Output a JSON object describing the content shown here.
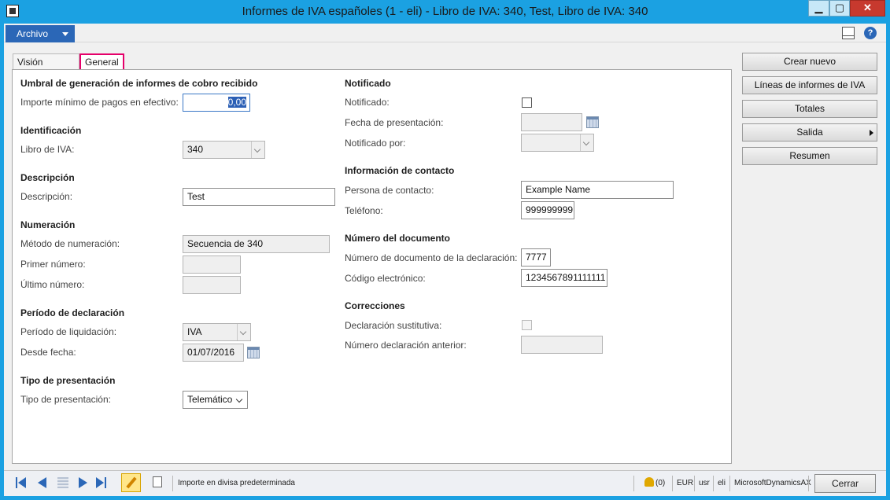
{
  "window": {
    "title": "Informes de IVA españoles (1 - eli) - Libro de IVA: 340, Test, Libro de IVA: 340",
    "minimize": "▁",
    "maximize": "▢",
    "close": "✕"
  },
  "menu": {
    "archivo": "Archivo",
    "help": "?"
  },
  "tabs": [
    {
      "label": "Visión general"
    },
    {
      "label": "General",
      "selected": true
    }
  ],
  "left": {
    "umbral": {
      "heading": "Umbral de generación de informes de cobro recibido",
      "importe_label": "Importe mínimo de pagos en efectivo:",
      "importe_value": "0,00"
    },
    "identificacion": {
      "heading": "Identificación",
      "libro_label": "Libro de IVA:",
      "libro_value": "340"
    },
    "descripcion": {
      "heading": "Descripción",
      "desc_label": "Descripción:",
      "desc_value": "Test"
    },
    "numeracion": {
      "heading": "Numeración",
      "metodo_label": "Método de numeración:",
      "metodo_value": "Secuencia de 340",
      "primer_label": "Primer número:",
      "primer_value": "",
      "ultimo_label": "Último número:",
      "ultimo_value": ""
    },
    "periodo": {
      "heading": "Período de declaración",
      "liquidacion_label": "Período de liquidación:",
      "liquidacion_value": "IVA",
      "desde_label": "Desde fecha:",
      "desde_value": "01/07/2016"
    },
    "tipo": {
      "heading": "Tipo de presentación",
      "tipo_label": "Tipo de presentación:",
      "tipo_value": "Telemático"
    }
  },
  "right": {
    "notificado": {
      "heading": "Notificado",
      "notificado_label": "Notificado:",
      "notificado_checked": false,
      "fecha_label": "Fecha de presentación:",
      "fecha_value": "",
      "por_label": "Notificado por:",
      "por_value": ""
    },
    "contacto": {
      "heading": "Información de contacto",
      "persona_label": "Persona de contacto:",
      "persona_value": "Example Name",
      "telefono_label": "Teléfono:",
      "telefono_value": "999999999"
    },
    "documento": {
      "heading": "Número del documento",
      "numero_label": "Número de documento de la declaración:",
      "numero_value": "7777",
      "codigo_label": "Código electrónico:",
      "codigo_value": "1234567891111111"
    },
    "correcciones": {
      "heading": "Correcciones",
      "sustitutiva_label": "Declaración sustitutiva:",
      "sustitutiva_checked": false,
      "anterior_label": "Número declaración anterior:",
      "anterior_value": ""
    }
  },
  "actions": [
    {
      "label": "Crear nuevo"
    },
    {
      "label": "Líneas de informes de IVA"
    },
    {
      "label": "Totales"
    },
    {
      "label": "Salida",
      "has_submenu": true
    },
    {
      "label": "Resumen"
    }
  ],
  "status": {
    "message": "Importe en divisa predeterminada",
    "notifications": "(0)",
    "currency": "EUR",
    "user": "usr",
    "company": "eli",
    "application": "MicrosoftDynamicsAX",
    "close_label": "Cerrar"
  },
  "colors": {
    "titlebar": "#1ba1e2",
    "archivo": "#2b67b7",
    "tab_highlight": "#e5006a",
    "close_button": "#c7392e"
  }
}
